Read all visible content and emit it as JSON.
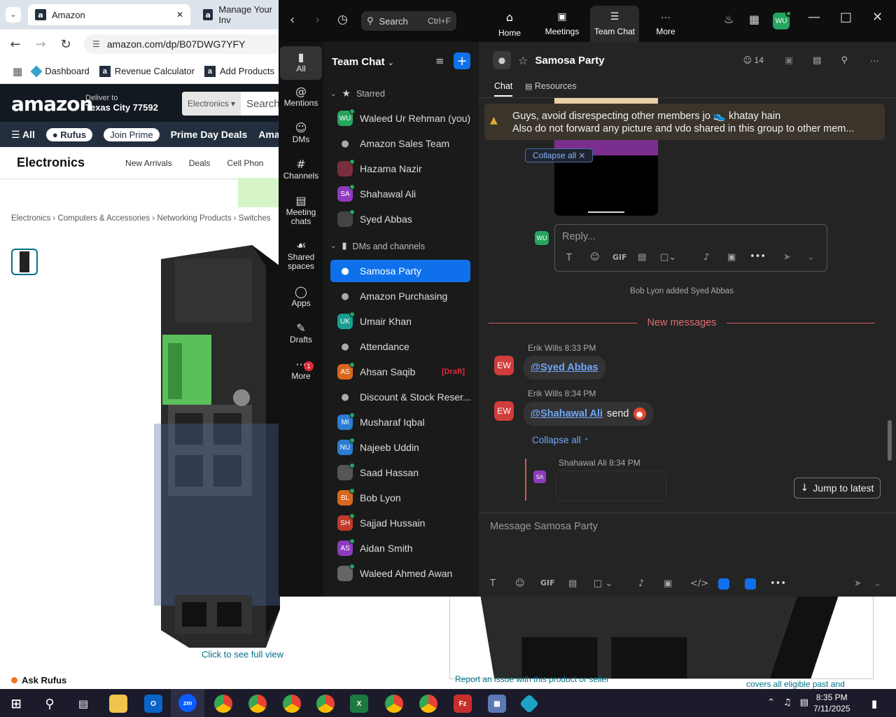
{
  "browser": {
    "tabs": [
      {
        "title": "Amazon",
        "favicon": "a"
      },
      {
        "title": "Manage Your Inv",
        "favicon": "a"
      }
    ],
    "url": "amazon.com/dp/B07DWG7YFY",
    "bookmarks": [
      "Dashboard",
      "Revenue Calculator",
      "Add Products"
    ]
  },
  "amazon": {
    "logo": "amazon",
    "deliver_label": "Deliver to",
    "deliver_location": "Texas City 77592",
    "search_category": "Electronics",
    "search_placeholder": "Search A",
    "nav": {
      "all": "All",
      "rufus": "Rufus",
      "join_prime": "Join Prime",
      "prime_day": "Prime Day Deals",
      "amazon": "Amazon"
    },
    "subnav": {
      "title": "Electronics",
      "links": [
        "New Arrivals",
        "Deals",
        "Cell Phon"
      ]
    },
    "breadcrumb": "Electronics › Computers & Accessories › Networking Products › Switches",
    "see_full_view": "Click to see full view",
    "ask_rufus": "Ask Rufus",
    "report_issue": "Report an issue with this product or seller",
    "covers_text": "covers all eligible past and"
  },
  "zoom": {
    "search_label": "Search",
    "search_shortcut": "Ctrl+F",
    "top_nav": [
      {
        "label": "Home",
        "icon": "home-icon"
      },
      {
        "label": "Meetings",
        "icon": "camera-icon"
      },
      {
        "label": "Team Chat",
        "icon": "chat-icon"
      },
      {
        "label": "More",
        "icon": "more-icon"
      }
    ],
    "user_initials": "WU",
    "rail": [
      {
        "label": "All"
      },
      {
        "label": "Mentions"
      },
      {
        "label": "DMs"
      },
      {
        "label": "Channels"
      },
      {
        "label": "Meeting chats"
      },
      {
        "label": "Shared spaces"
      },
      {
        "label": "Apps"
      },
      {
        "label": "Drafts"
      },
      {
        "label": "More"
      }
    ],
    "drafts_badge": "1",
    "sidebar": {
      "title": "Team Chat",
      "starred_label": "Starred",
      "dms_label": "DMs and channels",
      "starred": [
        {
          "name": "Waleed Ur Rehman (you)",
          "initials": "WU",
          "color": "#25a55f",
          "online": true
        },
        {
          "name": "Amazon Sales Team",
          "initials": "",
          "color": "lock"
        },
        {
          "name": "Hazama Nazir",
          "initials": "",
          "color": "#7a2e3b",
          "online": true
        },
        {
          "name": "Shahawal Ali",
          "initials": "SA",
          "color": "#8e3bbf",
          "online": true
        },
        {
          "name": "Syed Abbas",
          "initials": "",
          "color": "#444",
          "online": true
        }
      ],
      "channels": [
        {
          "name": "Samosa Party",
          "initials": "",
          "color": "lock",
          "selected": true
        },
        {
          "name": "Amazon Purchasing",
          "initials": "",
          "color": "lock"
        },
        {
          "name": "Umair Khan",
          "initials": "UK",
          "color": "#1a9e8f",
          "online": true
        },
        {
          "name": "Attendance",
          "initials": "",
          "color": "lock"
        },
        {
          "name": "Ahsan Saqib",
          "initials": "AS",
          "color": "#d9661e",
          "online": true,
          "draft": "[Draft]"
        },
        {
          "name": "Discount & Stock Reser...",
          "initials": "",
          "color": "lock"
        },
        {
          "name": "Musharaf Iqbal",
          "initials": "MI",
          "color": "#2b7cd3",
          "online": true
        },
        {
          "name": "Najeeb Uddin",
          "initials": "NU",
          "color": "#2b7cd3",
          "online": true
        },
        {
          "name": "Saad Hassan",
          "initials": "",
          "color": "#555",
          "online": true
        },
        {
          "name": "Bob Lyon",
          "initials": "BL",
          "color": "#d9661e",
          "online": true
        },
        {
          "name": "Sajjad Hussain",
          "initials": "SH",
          "color": "#c0392b",
          "online": true
        },
        {
          "name": "Aidan Smith",
          "initials": "AS",
          "color": "#8e3bbf",
          "online": true
        },
        {
          "name": "Waleed Ahmed Awan",
          "initials": "",
          "color": "#666",
          "online": true
        }
      ]
    },
    "chat": {
      "channel_name": "Samosa Party",
      "member_count": "14",
      "tabs": [
        "Chat",
        "Resources"
      ],
      "pinned_line1": "Guys, avoid disrespecting other members jo 👟 khatay hain",
      "pinned_line2": "Also do not forward any picture and vdo shared in this group to other mem...",
      "collapse_all": "Collapse all",
      "reply_placeholder": "Reply...",
      "reply_avatar": "WU",
      "system_message": "Bob Lyon added Syed Abbas",
      "new_messages": "New messages",
      "messages": [
        {
          "initials": "EW",
          "author": "Erik Wills",
          "time": "8:33 PM",
          "mention": "@Syed Abbas",
          "text": ""
        },
        {
          "initials": "EW",
          "author": "Erik Wills",
          "time": "8:34 PM",
          "mention": "@Shahawal Ali",
          "text": "send"
        }
      ],
      "thread_collapse": "Collapse all",
      "thread_reply": {
        "initials": "SA",
        "author": "Shahawal Ali",
        "time": "8:34 PM"
      },
      "jump_to_latest": "Jump to latest",
      "composer_placeholder": "Message Samosa Party"
    }
  },
  "taskbar": {
    "time": "8:35 PM",
    "date": "7/11/2025"
  }
}
